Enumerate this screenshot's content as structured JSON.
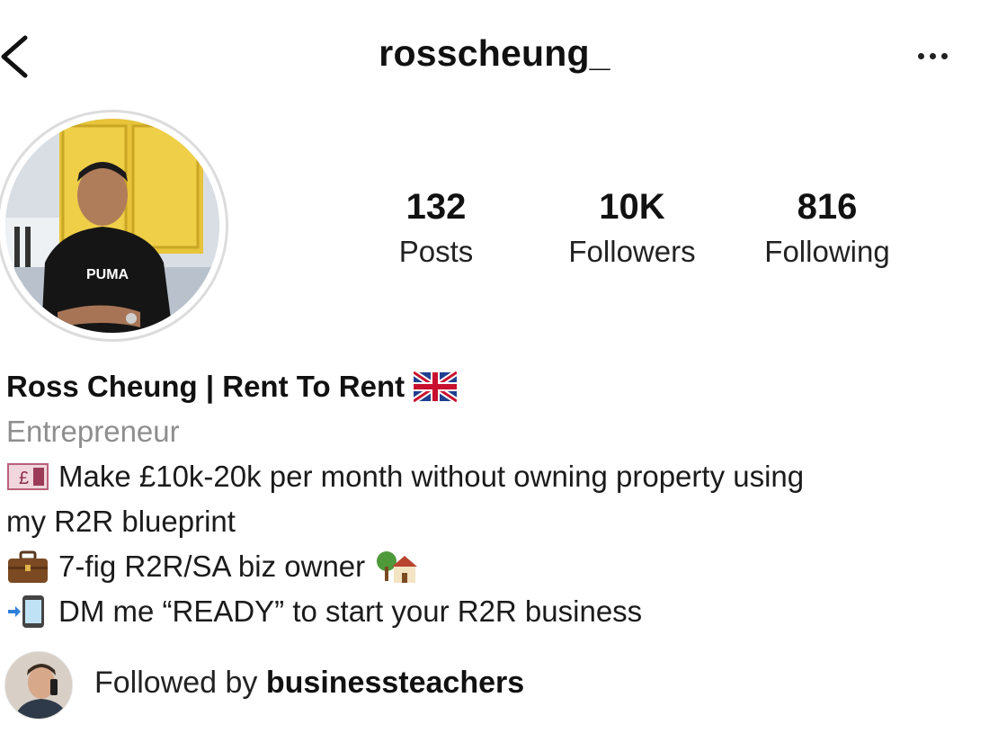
{
  "header": {
    "username": "rosscheung_",
    "back_icon": "chevron-left-icon",
    "more_icon": "more-horizontal-icon"
  },
  "profile": {
    "avatar_alt": "profile-photo",
    "stats": [
      {
        "value": "132",
        "label": "Posts"
      },
      {
        "value": "10K",
        "label": "Followers"
      },
      {
        "value": "816",
        "label": "Following"
      }
    ]
  },
  "bio": {
    "name": "Ross Cheung | Rent To Rent",
    "name_emoji": "uk-flag-icon",
    "category": "Entrepreneur",
    "lines": [
      {
        "icon": "pound-money-icon",
        "text": "Make £10k-20k per month without owning property using"
      },
      {
        "icon": "",
        "text": "my R2R blueprint"
      },
      {
        "icon": "briefcase-icon",
        "text": "7-fig R2R/SA biz owner",
        "trailing_icon": "house-with-tree-icon"
      },
      {
        "icon": "mobile-arrow-icon",
        "text": "DM me “READY” to start your R2R business"
      }
    ]
  },
  "followed_by": {
    "prefix": "Followed by",
    "username": "businessteachers"
  },
  "colors": {
    "text": "#262626",
    "secondary": "#8e8e8e",
    "avatar_ring": "#dcdcdc"
  }
}
